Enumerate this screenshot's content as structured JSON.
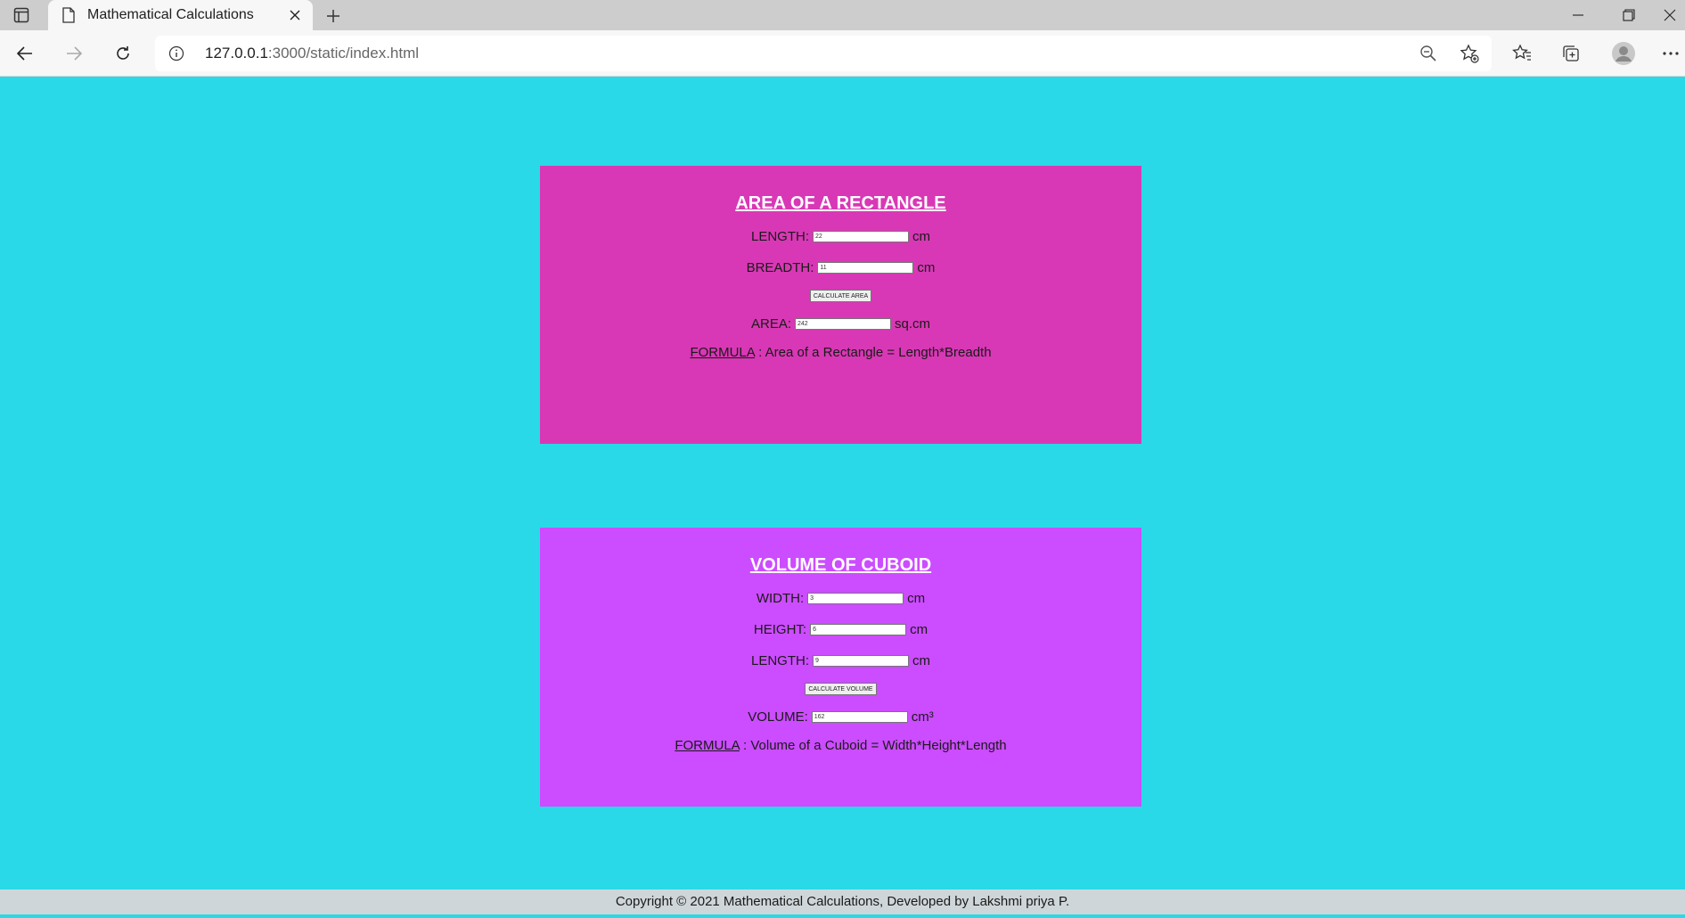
{
  "browser": {
    "tab_title": "Mathematical Calculations",
    "url_host": "127.0.0.1",
    "url_rest": ":3000/static/index.html"
  },
  "rectangle": {
    "heading": "AREA OF A RECTANGLE",
    "length_label": "LENGTH:",
    "length_value": "22",
    "length_unit": "cm",
    "breadth_label": "BREADTH:",
    "breadth_value": "11",
    "breadth_unit": "cm",
    "button_label": "CALCULATE AREA",
    "area_label": "AREA:",
    "area_value": "242",
    "area_unit": "sq.cm",
    "formula_label": "FORMULA",
    "formula_text": " : Area of a Rectangle = Length*Breadth"
  },
  "cuboid": {
    "heading": "VOLUME OF CUBOID",
    "width_label": "WIDTH:",
    "width_value": "3",
    "width_unit": "cm",
    "height_label": "HEIGHT:",
    "height_value": "6",
    "height_unit": "cm",
    "length_label": "LENGTH:",
    "length_value": "9",
    "length_unit": "cm",
    "button_label": "CALCULATE VOLUME",
    "volume_label": "VOLUME:",
    "volume_value": "162",
    "volume_unit": "cm³",
    "formula_label": "FORMULA",
    "formula_text": " : Volume of a Cuboid = Width*Height*Length"
  },
  "footer": {
    "text": "Copyright © 2021 Mathematical Calculations, Developed by Lakshmi priya P."
  }
}
